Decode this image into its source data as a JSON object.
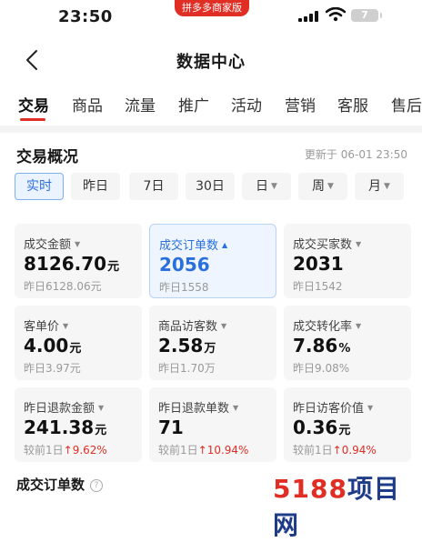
{
  "status": {
    "time": "23:50",
    "store_badge": "拼多多商家版",
    "battery": "7"
  },
  "nav": {
    "title": "数据中心"
  },
  "tabs": [
    "交易",
    "商品",
    "流量",
    "推广",
    "活动",
    "营销",
    "客服",
    "售后"
  ],
  "overview": {
    "title": "交易概况",
    "updated": "更新于 06-01 23:50",
    "filters": [
      "实时",
      "昨日",
      "7日",
      "30日",
      "日",
      "周",
      "月"
    ]
  },
  "cards": [
    {
      "label": "成交金额",
      "value": "8126.70",
      "unit": "元",
      "sub": "昨日6128.06元"
    },
    {
      "label": "成交订单数",
      "value": "2056",
      "unit": "",
      "sub": "昨日1558"
    },
    {
      "label": "成交买家数",
      "value": "2031",
      "unit": "",
      "sub": "昨日1542"
    },
    {
      "label": "客单价",
      "value": "4.00",
      "unit": "元",
      "sub": "昨日3.97元"
    },
    {
      "label": "商品访客数",
      "value": "2.58",
      "unit": "万",
      "sub": "昨日1.70万"
    },
    {
      "label": "成交转化率",
      "value": "7.86",
      "unit": "%",
      "sub": "昨日9.08%"
    },
    {
      "label": "昨日退款金额",
      "value": "241.38",
      "unit": "元",
      "sub_prefix": "较前1日",
      "sub_change": "9.62%"
    },
    {
      "label": "昨日退款单数",
      "value": "71",
      "unit": "",
      "sub_prefix": "较前1日",
      "sub_change": "10.94%"
    },
    {
      "label": "昨日访客价值",
      "value": "0.36",
      "unit": "元",
      "sub_prefix": "较前1日",
      "sub_change": "0.94%"
    }
  ],
  "bottom": {
    "title": "成交订单数"
  },
  "watermark": {
    "num": "5188",
    "text": "项目网"
  },
  "colors": {
    "accent": "#e02e24",
    "blue": "#2a6fdb"
  }
}
